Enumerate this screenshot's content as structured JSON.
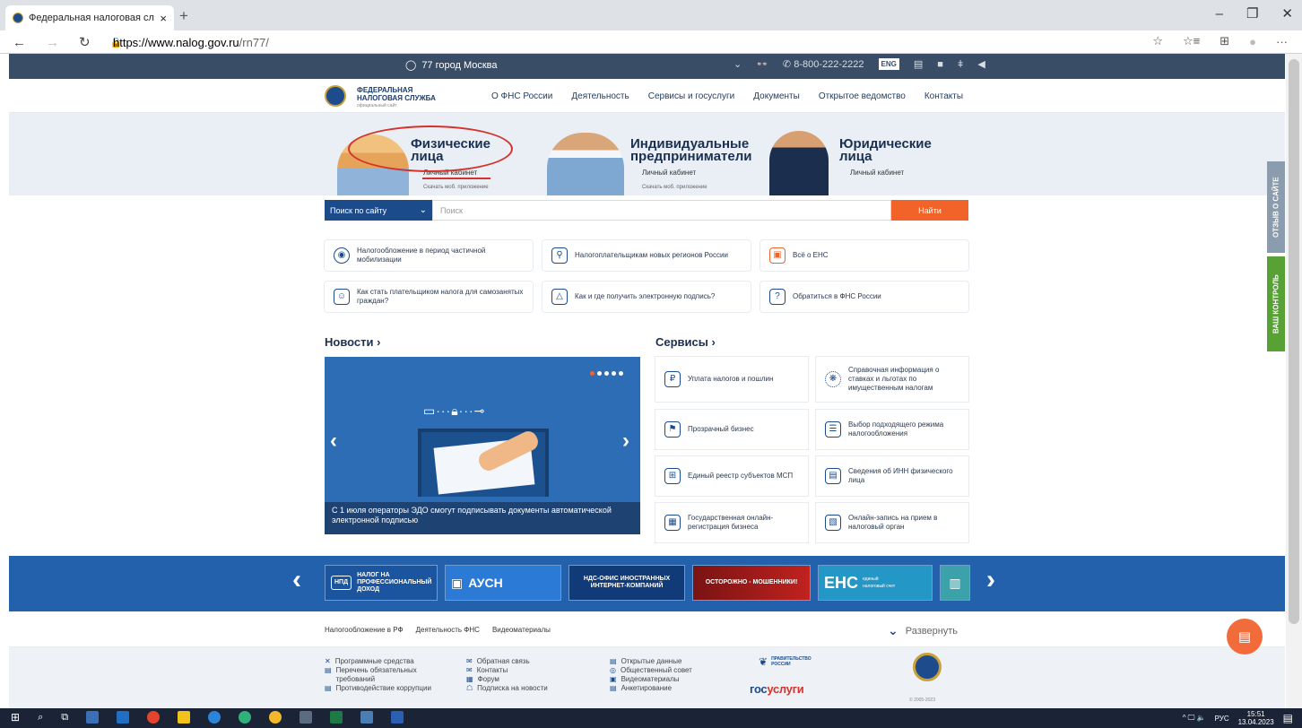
{
  "browser": {
    "tab_title": "Федеральная налоговая служб",
    "tab_close": "×",
    "new_tab": "+",
    "url_host": "https://www.nalog.gov.ru",
    "url_path": "/rn77/",
    "nav": {
      "back": "←",
      "forward": "→",
      "refresh": "↻",
      "lock": "🔒"
    },
    "window": {
      "minimize": "–",
      "maximize": "❐",
      "close": "✕"
    },
    "tools": [
      "☆",
      "☆≡",
      "⊞",
      "●",
      "···"
    ]
  },
  "topbar": {
    "region": "77 город Москва",
    "region_dropdown": "⌄",
    "phone": "8-800-222-2222",
    "eng": "ENG",
    "glasses": "👓"
  },
  "header": {
    "logo_line1": "ФЕДЕРАЛЬНАЯ",
    "logo_line2": "НАЛОГОВАЯ СЛУЖБА",
    "logo_sub": "официальный сайт",
    "nav": [
      "О ФНС России",
      "Деятельность",
      "Сервисы и госуслуги",
      "Документы",
      "Открытое ведомство",
      "Контакты"
    ]
  },
  "hero": {
    "fiz": {
      "title1": "Физические",
      "title2": "лица",
      "cabinet": "Личный кабинет",
      "app": "Скачать моб. приложение"
    },
    "ip": {
      "title1": "Индивидуальные",
      "title2": "предприниматели",
      "cabinet": "Личный кабинет",
      "app": "Скачать моб. приложение"
    },
    "yur": {
      "title1": "Юридические",
      "title2": "лица",
      "cabinet": "Личный кабинет"
    }
  },
  "search": {
    "select": "Поиск по сайту",
    "placeholder": "Поиск",
    "button": "Найти"
  },
  "quick": [
    "Налогообложение в период частичной мобилизации",
    "Налогоплательщикам новых регионов России",
    "Всё о ЕНС",
    "Как стать плательщиком налога для самозанятых граждан?",
    "Как и где получить электронную подпись?",
    "Обратиться в ФНС России"
  ],
  "news": {
    "title": "Новости ›",
    "caption": "С 1 июля операторы ЭДО смогут подписывать документы автоматической электронной подписью",
    "prev": "‹",
    "next": "›"
  },
  "services": {
    "title": "Сервисы ›",
    "items": [
      "Уплата налогов и пошлин",
      "Справочная информация о ставках и льготах по имущественным налогам",
      "Прозрачный бизнес",
      "Выбор подходящего режима налогообложения",
      "Единый реестр субъектов МСП",
      "Сведения об ИНН физического лица",
      "Государственная онлайн-регистрация бизнеса",
      "Онлайн-запись на прием в налоговый орган"
    ]
  },
  "banners": {
    "prev": "‹",
    "next": "›",
    "npd": "НАЛОГ НА ПРОФЕССИОНАЛЬНЫЙ ДОХОД",
    "npd_badge": "НПД",
    "ausn": "АУСН",
    "nds": "НДС-ОФИС ИНОСТРАННЫХ ИНТЕРНЕТ-КОМПАНИЙ",
    "scam": "ОСТОРОЖНО - МОШЕННИКИ!",
    "ens": "ЕНС",
    "ens_sub": "единый налоговый счет"
  },
  "footer": {
    "tabs": [
      "Налогообложение в РФ",
      "Деятельность ФНС",
      "Видеоматериалы"
    ],
    "expand": "Развернуть",
    "col1": [
      "Программные средства",
      "Перечень обязательных требований",
      "Противодействие коррупции"
    ],
    "col2": [
      "Обратная связь",
      "Контакты",
      "Форум",
      "Подписка на новости"
    ],
    "col3": [
      "Открытые данные",
      "Общественный совет",
      "Видеоматериалы",
      "Анкетирование"
    ],
    "gov_line1": "ПРАВИТЕЛЬСТВО",
    "gov_line2": "РОССИИ",
    "gosuslugi_a": "гос",
    "gosuslugi_b": "услуги",
    "copyright": "© 2005-2023"
  },
  "side": {
    "feedback": "ОТЗЫВ О САЙТЕ",
    "control": "ВАШ КОНТРОЛЬ"
  },
  "taskbar": {
    "lang": "РУС",
    "time": "15:51",
    "date": "13.04.2023",
    "tray_icons": "^ 🖵 🔈"
  },
  "colors": {
    "brand": "#1c4b8c",
    "accent": "#f2632a",
    "highlight": "#d6322c"
  }
}
